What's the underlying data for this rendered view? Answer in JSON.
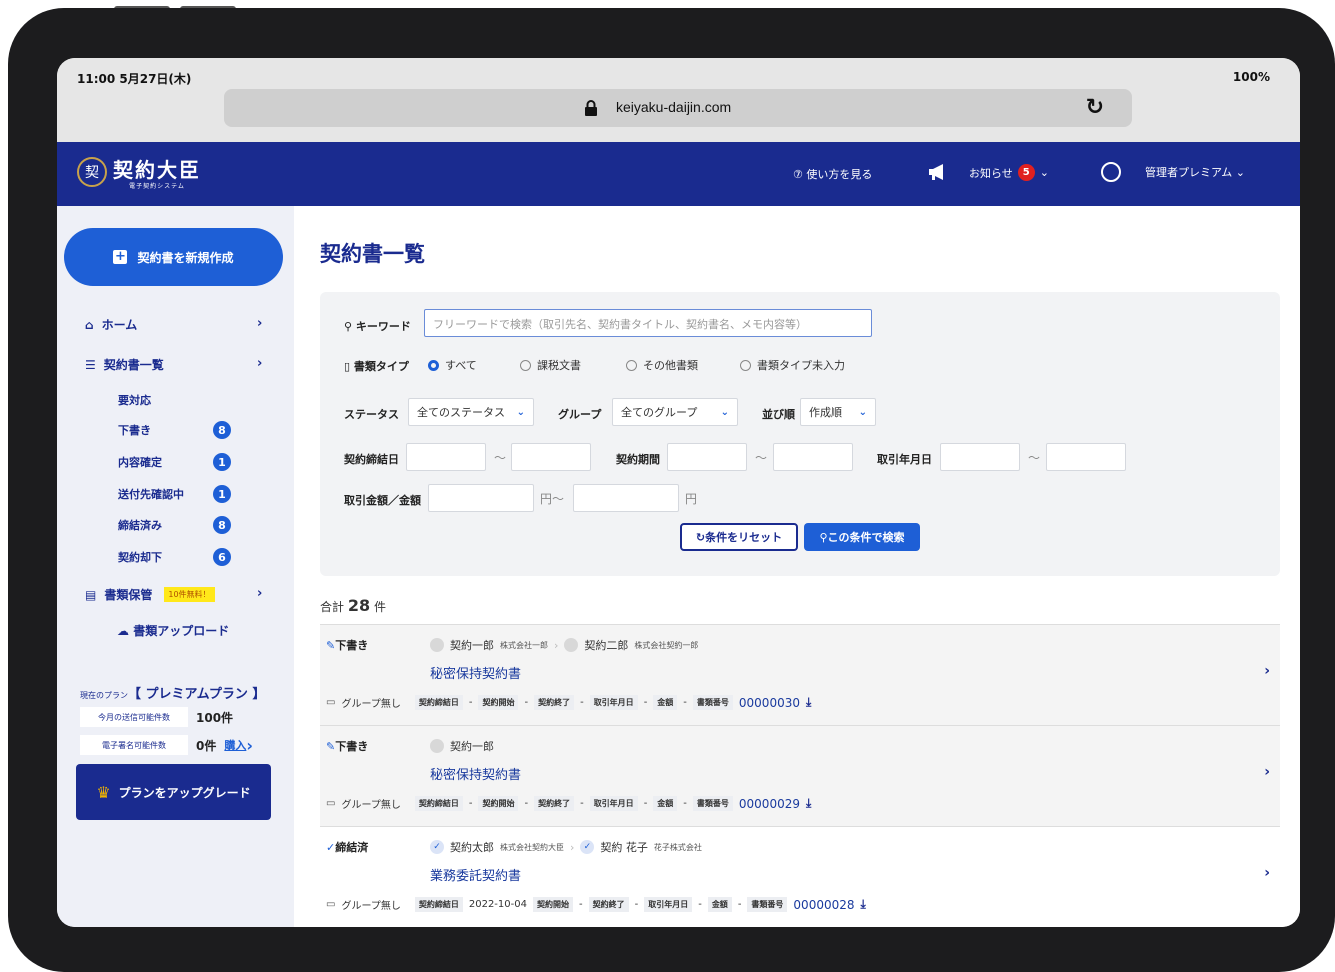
{
  "status_bar": {
    "time": "11:00 5月27日(木)",
    "battery": "100%"
  },
  "browser": {
    "url": "keiyaku-daijin.com"
  },
  "header": {
    "logo_seal": "契",
    "logo_main": "契約大臣",
    "logo_sub": "電子契約システム",
    "help": "⑦ 使い方を見る",
    "notice_label": "お知らせ",
    "notice_count": "5",
    "user_label": "管理者プレミアム"
  },
  "sidebar": {
    "new_button": "契約書を新規作成",
    "home": "ホーム",
    "list": "契約書一覧",
    "sub_items": [
      {
        "label": "要対応",
        "count": ""
      },
      {
        "label": "下書き",
        "count": "8"
      },
      {
        "label": "内容確定",
        "count": "1"
      },
      {
        "label": "送付先確認中",
        "count": "1"
      },
      {
        "label": "締結済み",
        "count": "8"
      },
      {
        "label": "契約却下",
        "count": "6"
      }
    ],
    "storage": "書類保管",
    "storage_tag": "10件無料！",
    "upload": "書類アップロード",
    "plan_prefix": "現在のプラン",
    "plan_name": "【 プレミアムプラン 】",
    "send_label": "今月の送信可能件数",
    "send_value": "100件",
    "sign_label": "電子署名可能件数",
    "sign_value": "0件",
    "buy": "購入",
    "upgrade": "プランをアップグレード"
  },
  "main": {
    "title": "契約書一覧",
    "filters": {
      "keyword_label": "キーワード",
      "keyword_placeholder": "フリーワードで検索（取引先名、契約書タイトル、契約書名、メモ内容等）",
      "doctype_label": "書類タイプ",
      "doctype_options": [
        "すべて",
        "課税文書",
        "その他書類",
        "書類タイプ未入力"
      ],
      "status_label": "ステータス",
      "status_value": "全てのステータス",
      "group_label": "グループ",
      "group_value": "全てのグループ",
      "sort_label": "並び順",
      "sort_value": "作成順",
      "sign_date_label": "契約締結日",
      "period_label": "契約期間",
      "trade_date_label": "取引年月日",
      "amount_label": "取引金額／金額",
      "yen_tilde": "円～",
      "yen": "円",
      "tilde": "～",
      "reset": "条件をリセット",
      "search": "この条件で検索"
    },
    "total_prefix": "合計",
    "total_count": "28",
    "total_suffix": "件",
    "contracts": [
      {
        "status": "下書き",
        "p1_name": "契約一郎",
        "p1_co": "株式会社一郎",
        "p2_name": "契約二郎",
        "p2_co": "株式会社契約一郎",
        "title": "秘密保持契約書",
        "group": "グループ無し",
        "sign_date": "-",
        "start": "-",
        "end": "-",
        "trade": "-",
        "amount": "-",
        "docnum": "00000030"
      },
      {
        "status": "下書き",
        "p1_name": "契約一郎",
        "p1_co": "",
        "title": "秘密保持契約書",
        "group": "グループ無し",
        "sign_date": "-",
        "start": "-",
        "end": "-",
        "trade": "-",
        "amount": "-",
        "docnum": "00000029"
      },
      {
        "status": "締結済",
        "p1_name": "契約太郎",
        "p1_co": "株式会社契約大臣",
        "p2_name": "契約 花子",
        "p2_co": "花子株式会社",
        "title": "業務委託契約書",
        "group": "グループ無し",
        "sign_date": "2022-10-04",
        "start": "-",
        "end": "-",
        "trade": "-",
        "amount": "-",
        "docnum": "00000028"
      }
    ],
    "meta_labels": {
      "sign": "契約締結日",
      "start": "契約開始",
      "end": "契約終了",
      "trade": "取引年月日",
      "amount": "金額",
      "docnum": "書類番号"
    }
  }
}
